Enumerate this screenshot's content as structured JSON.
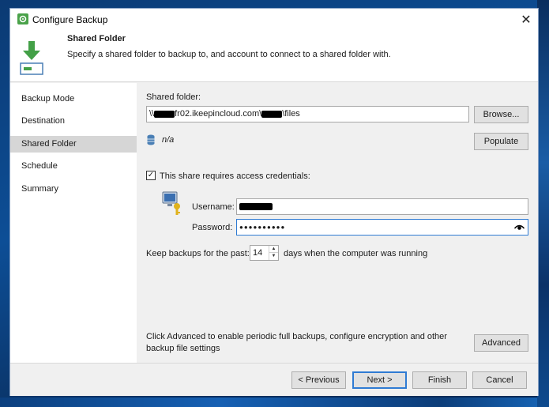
{
  "window": {
    "title": "Configure Backup"
  },
  "header": {
    "title": "Shared Folder",
    "subtitle": "Specify a shared folder to backup to, and account to connect to a shared folder with."
  },
  "sidebar": {
    "items": [
      {
        "label": "Backup Mode"
      },
      {
        "label": "Destination"
      },
      {
        "label": "Shared Folder",
        "active": true
      },
      {
        "label": "Schedule"
      },
      {
        "label": "Summary"
      }
    ]
  },
  "shared_folder": {
    "label": "Shared folder:",
    "path_prefix": "\\\\",
    "path_mid": "fr02.ikeepincloud.com\\",
    "path_suffix": "\\files",
    "browse_label": "Browse...",
    "status_text": "n/a",
    "populate_label": "Populate"
  },
  "credentials": {
    "checkbox_label": "This share requires access credentials:",
    "checked": true,
    "username_label": "Username:",
    "password_label": "Password:",
    "password_mask": "●●●●●●●●●●"
  },
  "retention": {
    "prefix": "Keep backups for the past:",
    "value": "14",
    "suffix": "days when the computer was running"
  },
  "advanced": {
    "text_line1": "Click Advanced to enable periodic full backups, configure encryption and other",
    "text_line2": "backup file settings",
    "button_label": "Advanced"
  },
  "footer": {
    "previous_label": "< Previous",
    "next_label": "Next >",
    "finish_label": "Finish",
    "cancel_label": "Cancel"
  },
  "colors": {
    "accent": "#2f7bd3",
    "header_icon_green": "#4caf50",
    "desktop_blue": "#0d4e96"
  }
}
